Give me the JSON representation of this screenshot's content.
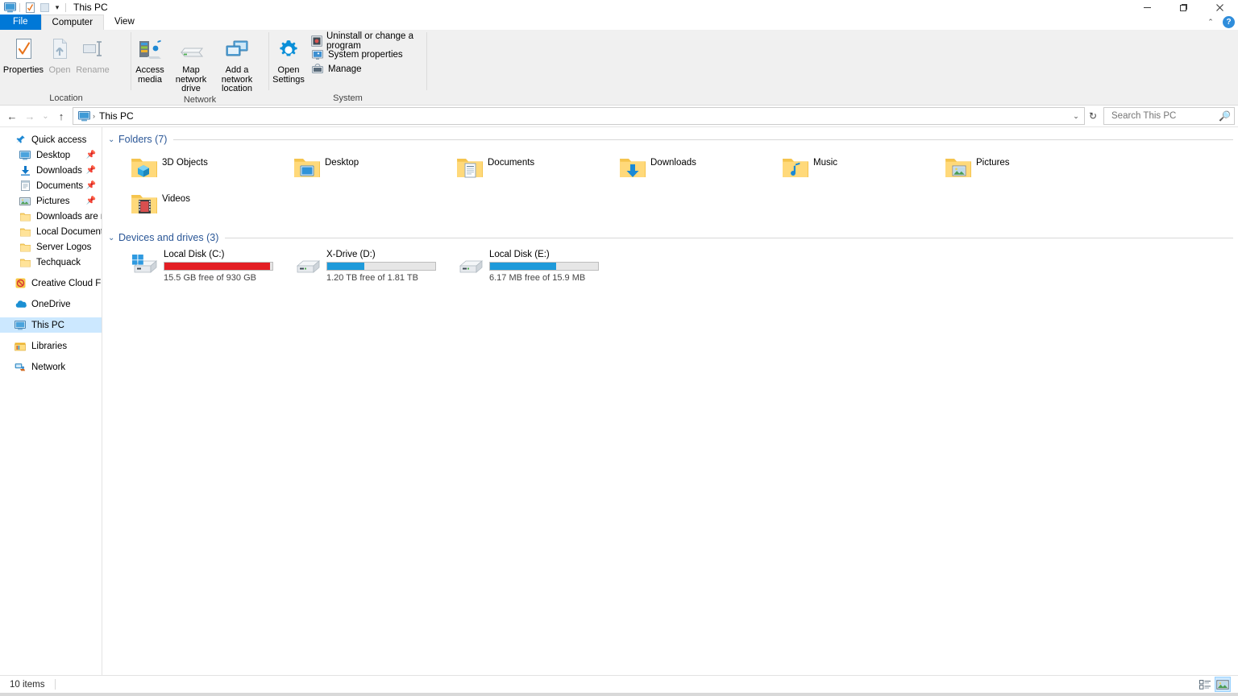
{
  "window": {
    "title": "This PC",
    "quick_access_toolbar": [
      {
        "name": "this-pc-icon",
        "label": "This PC"
      },
      {
        "name": "properties-icon",
        "label": "Properties"
      },
      {
        "name": "new-folder-icon",
        "label": "New folder"
      },
      {
        "name": "customize-chevron-icon",
        "label": "Customize Quick Access Toolbar"
      }
    ],
    "controls": {
      "minimize": "─",
      "maximize": "❐",
      "close": "✕"
    }
  },
  "tabs": [
    {
      "label": "File",
      "type": "file",
      "active": false
    },
    {
      "label": "Computer",
      "type": "normal",
      "active": true
    },
    {
      "label": "View",
      "type": "normal",
      "active": false
    }
  ],
  "ribbon": {
    "collapse_chevron": "⌃",
    "help_label": "?",
    "groups": [
      {
        "name": "location",
        "label": "Location",
        "buttons": [
          {
            "label": "Properties",
            "icon": "properties-icon",
            "disabled": false
          },
          {
            "label": "Open",
            "icon": "open-icon",
            "disabled": true
          },
          {
            "label": "Rename",
            "icon": "rename-icon",
            "disabled": true
          }
        ]
      },
      {
        "name": "network",
        "label": "Network",
        "buttons": [
          {
            "label": "Access media",
            "icon": "access-media-icon",
            "dropdown": true
          },
          {
            "label": "Map network drive",
            "icon": "map-network-drive-icon",
            "dropdown": true
          },
          {
            "label": "Add a network location",
            "icon": "add-network-location-icon",
            "dropdown": false
          }
        ]
      },
      {
        "name": "system",
        "label": "System",
        "buttons": [
          {
            "label": "Open Settings",
            "icon": "open-settings-icon",
            "dropdown": false
          }
        ],
        "small_commands": [
          {
            "label": "Uninstall or change a program",
            "icon": "uninstall-program-icon"
          },
          {
            "label": "System properties",
            "icon": "system-properties-icon"
          },
          {
            "label": "Manage",
            "icon": "manage-icon"
          }
        ]
      }
    ]
  },
  "navigation": {
    "back": "←",
    "forward": "→",
    "recent": "⌄",
    "up": "↑",
    "breadcrumb": {
      "icon": "this-pc-icon",
      "separator": "›",
      "path": "This PC"
    },
    "dropdown": "⌄",
    "refresh": "↻"
  },
  "search": {
    "placeholder": "Search This PC",
    "value": "",
    "icon": "search-icon"
  },
  "sidebar": {
    "items": [
      {
        "label": "Quick access",
        "icon": "pin-star-icon",
        "level": 1,
        "pinned": false,
        "selected": false
      },
      {
        "label": "Desktop",
        "icon": "desktop-icon",
        "level": 2,
        "pinned": true,
        "selected": false
      },
      {
        "label": "Downloads",
        "icon": "downloads-icon",
        "level": 2,
        "pinned": true,
        "selected": false
      },
      {
        "label": "Documents",
        "icon": "documents-icon",
        "level": 2,
        "pinned": true,
        "selected": false
      },
      {
        "label": "Pictures",
        "icon": "pictures-icon",
        "level": 2,
        "pinned": true,
        "selected": false
      },
      {
        "label": "Downloads are now",
        "icon": "folder-icon",
        "level": 2,
        "pinned": false,
        "selected": false
      },
      {
        "label": "Local Documents",
        "icon": "folder-icon",
        "level": 2,
        "pinned": false,
        "selected": false
      },
      {
        "label": "Server Logos",
        "icon": "folder-icon",
        "level": 2,
        "pinned": false,
        "selected": false
      },
      {
        "label": "Techquack",
        "icon": "folder-icon",
        "level": 2,
        "pinned": false,
        "selected": false
      },
      {
        "label": "Creative Cloud Files",
        "icon": "creative-cloud-icon",
        "level": 1,
        "pinned": false,
        "selected": false
      },
      {
        "label": "OneDrive",
        "icon": "onedrive-icon",
        "level": 1,
        "pinned": false,
        "selected": false
      },
      {
        "label": "This PC",
        "icon": "this-pc-icon",
        "level": 1,
        "pinned": false,
        "selected": true
      },
      {
        "label": "Libraries",
        "icon": "libraries-icon",
        "level": 1,
        "pinned": false,
        "selected": false
      },
      {
        "label": "Network",
        "icon": "network-icon",
        "level": 1,
        "pinned": false,
        "selected": false
      }
    ]
  },
  "content": {
    "sections": [
      {
        "name": "folders",
        "title": "Folders (7)",
        "chevron": "⌄",
        "items": [
          {
            "label": "3D Objects",
            "icon": "folder-3d-objects-icon"
          },
          {
            "label": "Desktop",
            "icon": "folder-desktop-icon"
          },
          {
            "label": "Documents",
            "icon": "folder-documents-icon"
          },
          {
            "label": "Downloads",
            "icon": "folder-downloads-icon"
          },
          {
            "label": "Music",
            "icon": "folder-music-icon"
          },
          {
            "label": "Pictures",
            "icon": "folder-pictures-icon"
          },
          {
            "label": "Videos",
            "icon": "folder-videos-icon"
          }
        ]
      },
      {
        "name": "devices-and-drives",
        "title": "Devices and drives (3)",
        "chevron": "⌄",
        "items": [
          {
            "label": "Local Disk (C:)",
            "icon": "windows-drive-icon",
            "free_text": "15.5 GB free of 930 GB",
            "used_percent": 98,
            "bar_color": "#e31e24"
          },
          {
            "label": "X-Drive (D:)",
            "icon": "drive-icon",
            "free_text": "1.20 TB free of 1.81 TB",
            "used_percent": 34,
            "bar_color": "#1e9ada"
          },
          {
            "label": "Local Disk (E:)",
            "icon": "drive-icon",
            "free_text": "6.17 MB free of 15.9 MB",
            "used_percent": 61,
            "bar_color": "#1e9ada"
          }
        ]
      }
    ]
  },
  "statusbar": {
    "item_count": "10 items",
    "views": [
      {
        "name": "details-view-button",
        "label": "Details view",
        "active": false
      },
      {
        "name": "large-icons-view-button",
        "label": "Large icons view",
        "active": true
      }
    ]
  },
  "colors": {
    "accent": "#0078d7",
    "section_header": "#2b5797",
    "selection": "#cce8ff",
    "drive_red": "#e31e24",
    "drive_blue": "#1e9ada",
    "ribbon_bg": "#f0f0f0"
  }
}
